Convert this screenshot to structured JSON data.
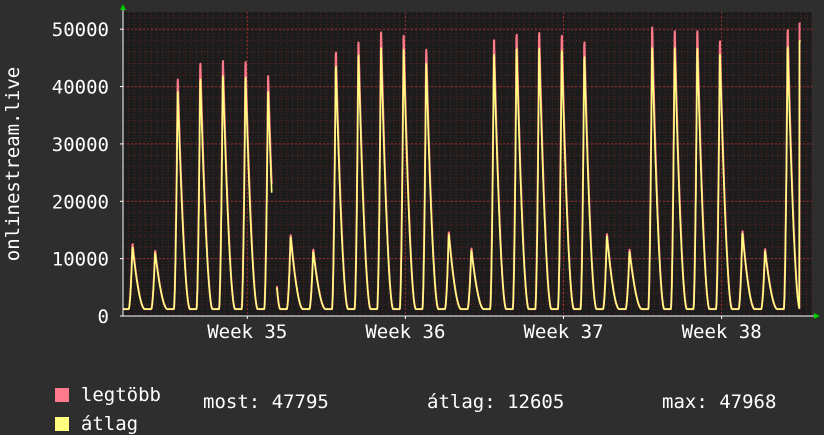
{
  "chart_data": {
    "type": "line",
    "ylabel": "onlinestream.live",
    "ylim": [
      0,
      53000
    ],
    "y_ticks": [
      0,
      10000,
      20000,
      30000,
      40000,
      50000
    ],
    "y_tick_labels": [
      "0",
      "10000",
      "20000",
      "30000",
      "40000",
      "50000"
    ],
    "x_range_days": [
      0,
      30.5
    ],
    "x_ticks": [
      {
        "label": "Week 35",
        "day": 5.5
      },
      {
        "label": "Week 36",
        "day": 12.5
      },
      {
        "label": "Week 37",
        "day": 19.5
      },
      {
        "label": "Week 38",
        "day": 26.5
      }
    ],
    "grid": true,
    "legend": "bottom-left",
    "series": [
      {
        "name": "legtöbb",
        "color": "#ff7a8a",
        "daily_peaks": [
          12800,
          11600,
          42200,
          45000,
          45500,
          45300,
          42800,
          14400,
          11800,
          47000,
          48800,
          50600,
          50000,
          47500,
          14900,
          12000,
          49200,
          50200,
          50500,
          50000,
          48800,
          14600,
          11800,
          51500,
          50800,
          50800,
          49000,
          15100,
          11900,
          51000
        ]
      },
      {
        "name": "átlag",
        "color": "#ffff80",
        "daily_peaks": [
          12200,
          11200,
          40000,
          42200,
          42800,
          42500,
          40000,
          14000,
          11400,
          44500,
          46500,
          47800,
          47500,
          45000,
          14500,
          11600,
          46600,
          47600,
          47700,
          47300,
          46200,
          14200,
          11400,
          47800,
          47800,
          47700,
          46600,
          14700,
          11500,
          47968
        ]
      }
    ],
    "gap_day": 6.7,
    "baseline": 1200
  },
  "legend": {
    "items": [
      {
        "label": "legtöbb",
        "color": "#ff7a8a"
      },
      {
        "label": "átlag",
        "color": "#ffff80"
      }
    ]
  },
  "stats": {
    "most": "most: 47795",
    "atlag": "átlag: 12605",
    "max": "max: 47968"
  },
  "colors": {
    "background": "#2e2e2e",
    "plot_background": "#1c1c1c",
    "grid": "#a03030",
    "axis_arrow": "#00cc00"
  }
}
